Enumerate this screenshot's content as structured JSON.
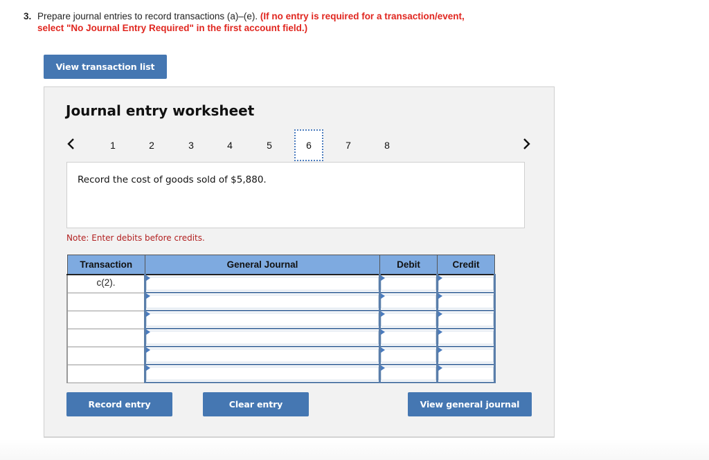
{
  "question": {
    "number": "3.",
    "text": "Prepare journal entries to record transactions (a)–(e).",
    "instruction_line1": "(If no entry is required for a transaction/event,",
    "instruction_line2": "select \"No Journal Entry Required\" in the first account field.)"
  },
  "buttons": {
    "view_transaction_list": "View transaction list",
    "record_entry": "Record entry",
    "clear_entry": "Clear entry",
    "view_general_journal": "View general journal"
  },
  "worksheet": {
    "title": "Journal entry worksheet",
    "tabs": [
      "1",
      "2",
      "3",
      "4",
      "5",
      "6",
      "7",
      "8"
    ],
    "active_tab": "6",
    "description": "Record the cost of goods sold of $5,880.",
    "note": "Note: Enter debits before credits."
  },
  "table": {
    "headers": {
      "transaction": "Transaction",
      "general_journal": "General Journal",
      "debit": "Debit",
      "credit": "Credit"
    },
    "rows": [
      {
        "transaction": "c(2).",
        "account": "",
        "debit": "",
        "credit": ""
      },
      {
        "transaction": "",
        "account": "",
        "debit": "",
        "credit": ""
      },
      {
        "transaction": "",
        "account": "",
        "debit": "",
        "credit": ""
      },
      {
        "transaction": "",
        "account": "",
        "debit": "",
        "credit": ""
      },
      {
        "transaction": "",
        "account": "",
        "debit": "",
        "credit": ""
      },
      {
        "transaction": "",
        "account": "",
        "debit": "",
        "credit": ""
      }
    ]
  },
  "icons": {
    "prev": "chevron-left-icon",
    "next": "chevron-right-icon"
  },
  "colors": {
    "button_blue": "#4577b2",
    "header_blue": "#7eaae0",
    "instruction_red": "#e0261f",
    "note_red": "#b22020"
  }
}
